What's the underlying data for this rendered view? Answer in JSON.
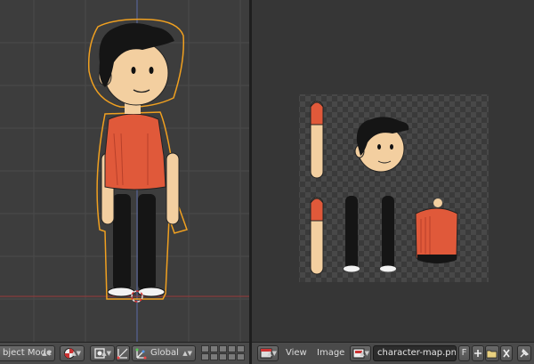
{
  "viewport_3d": {
    "header": {
      "mode_label": "bject Mode",
      "orientation_label": "Global"
    }
  },
  "image_editor": {
    "header": {
      "view_label": "View",
      "image_label": "Image",
      "image_name": "character-map.png",
      "fake_user_label": "F"
    }
  },
  "colors": {
    "shirt": "#e0593a",
    "selection_outline": "#f0a020",
    "background_3d": "#3d3d3d",
    "background_image_editor": "#363636",
    "header": "#4a4a4a"
  },
  "icons": [
    "record-icon",
    "pivot-icon",
    "manipulator-icon",
    "transform-orientation-icon",
    "layers-grid",
    "editor-type-icon",
    "image-browse-icon",
    "new-image-icon",
    "open-image-icon",
    "unlink-icon",
    "pin-icon"
  ]
}
